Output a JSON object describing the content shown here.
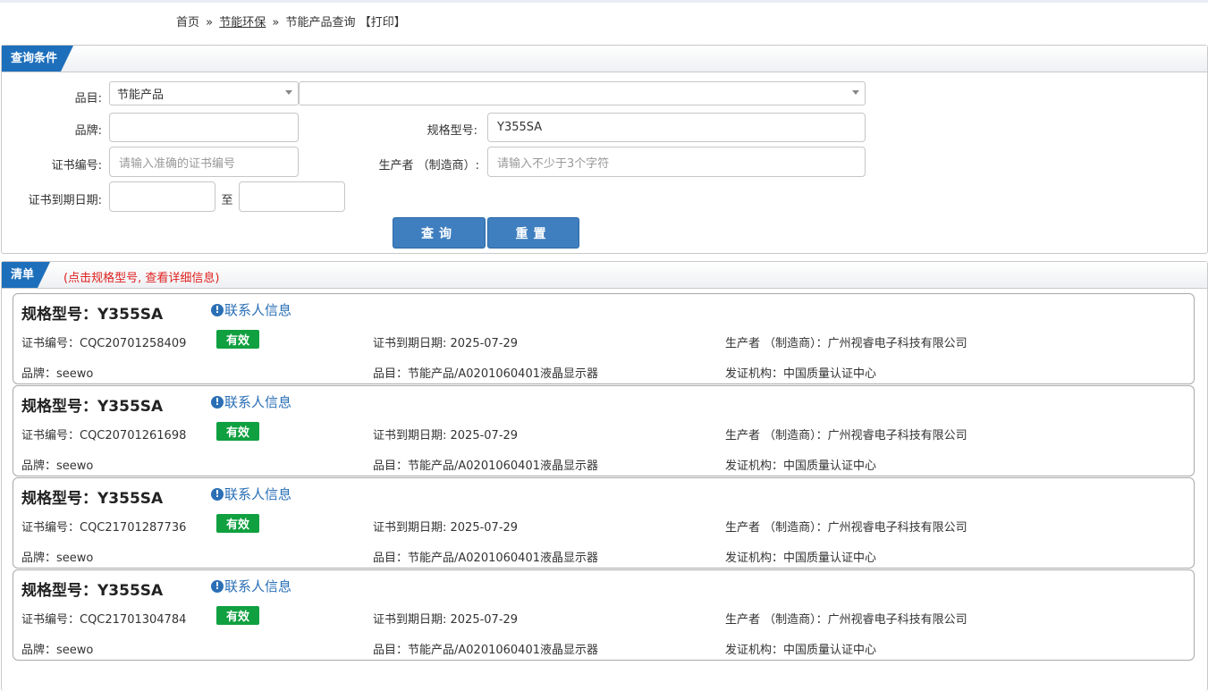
{
  "breadcrumb": {
    "home": "首页",
    "sep1": "»",
    "section": "节能环保",
    "sep2": "»",
    "current": "节能产品查询",
    "print": "【打印】"
  },
  "query": {
    "title": "查询条件",
    "category_label": "品目:",
    "category_value": "节能产品",
    "subcategory_value": "",
    "brand_label": "品牌:",
    "brand_value": "",
    "model_label": "规格型号:",
    "model_value": "Y355SA",
    "cert_no_label": "证书编号:",
    "cert_no_placeholder": "请输入准确的证书编号",
    "maker_label": "生产者 （制造商）:",
    "maker_placeholder": "请输入不少于3个字符",
    "expiry_label": "证书到期日期:",
    "expiry_from": "",
    "expiry_to_sep": "至",
    "expiry_to": "",
    "search_button": "查询",
    "reset_button": "重置"
  },
  "list": {
    "title": "清单",
    "note": "(点击规格型号, 查看详细信息)",
    "contact_label": "联系人信息",
    "items": [
      {
        "model": "规格型号：Y355SA",
        "cert_no": "证书编号：CQC20701258409",
        "status": "有效",
        "expiry": "证书到期日期: 2025-07-29",
        "maker": "生产者 （制造商）：广州视睿电子科技有限公司",
        "brand": "品牌：seewo",
        "category": "品目：节能产品/A0201060401液晶显示器",
        "issuer": "发证机构：中国质量认证中心"
      },
      {
        "model": "规格型号：Y355SA",
        "cert_no": "证书编号：CQC20701261698",
        "status": "有效",
        "expiry": "证书到期日期: 2025-07-29",
        "maker": "生产者 （制造商）：广州视睿电子科技有限公司",
        "brand": "品牌：seewo",
        "category": "品目：节能产品/A0201060401液晶显示器",
        "issuer": "发证机构：中国质量认证中心"
      },
      {
        "model": "规格型号：Y355SA",
        "cert_no": "证书编号：CQC21701287736",
        "status": "有效",
        "expiry": "证书到期日期: 2025-07-29",
        "maker": "生产者 （制造商）：广州视睿电子科技有限公司",
        "brand": "品牌：seewo",
        "category": "品目：节能产品/A0201060401液晶显示器",
        "issuer": "发证机构：中国质量认证中心"
      },
      {
        "model": "规格型号：Y355SA",
        "cert_no": "证书编号：CQC21701304784",
        "status": "有效",
        "expiry": "证书到期日期: 2025-07-29",
        "maker": "生产者 （制造商）：广州视睿电子科技有限公司",
        "brand": "品牌：seewo",
        "category": "品目：节能产品/A0201060401液晶显示器",
        "issuer": "发证机构：中国质量认证中心"
      }
    ]
  },
  "colors": {
    "tab_blue": "#1d6fbb",
    "button_blue": "#3f7fbf",
    "valid_green": "#10a040",
    "link_blue": "#2a6fb6",
    "note_red": "#e02020"
  }
}
